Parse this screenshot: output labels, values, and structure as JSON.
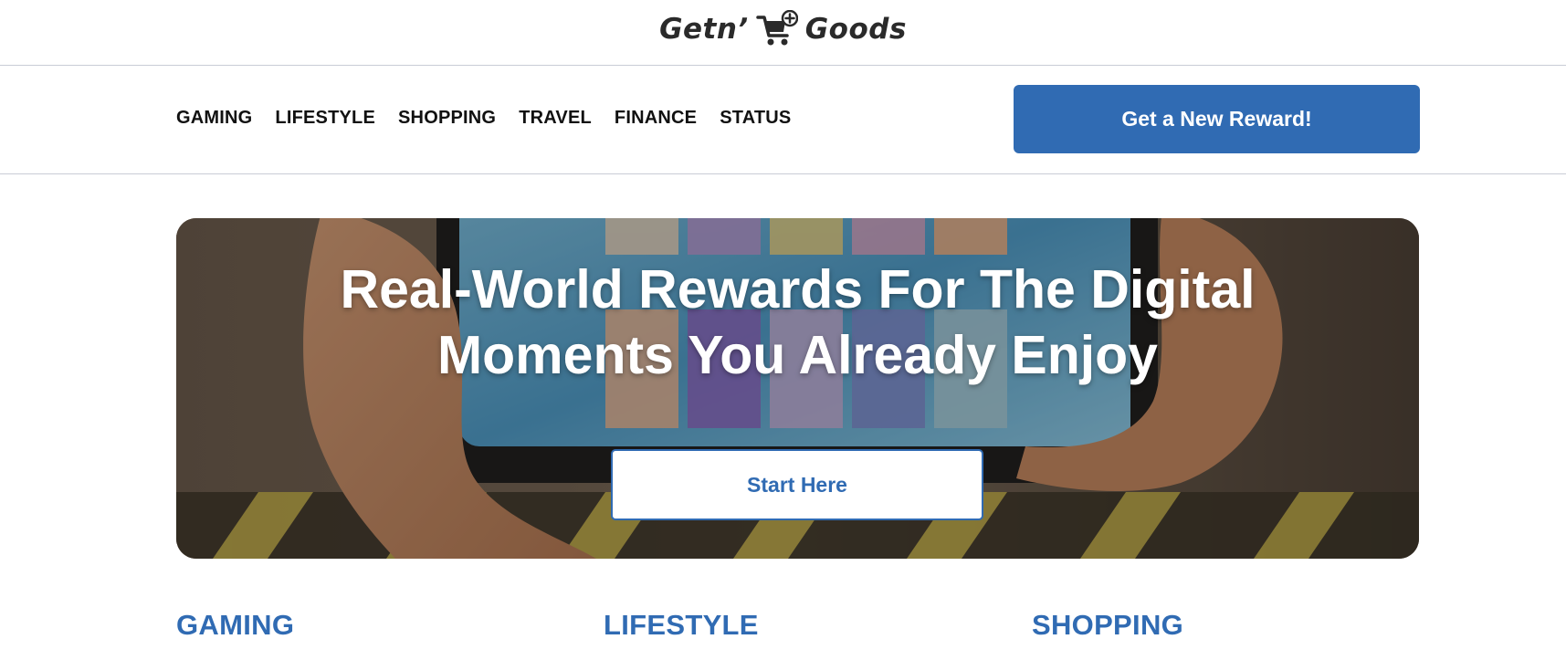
{
  "logo": {
    "text_left": "Getn’",
    "text_right": "Goods",
    "icon": "shopping-cart-plus-icon"
  },
  "nav": {
    "links": [
      {
        "label": "GAMING"
      },
      {
        "label": "LIFESTYLE"
      },
      {
        "label": "SHOPPING"
      },
      {
        "label": "TRAVEL"
      },
      {
        "label": "FINANCE"
      },
      {
        "label": "STATUS"
      }
    ],
    "cta_label": "Get a New Reward!"
  },
  "hero": {
    "title_line1": "Real-World Rewards For The Digital",
    "title_line2": "Moments You Already Enjoy",
    "button_label": "Start Here",
    "image": "hands-holding-phone-playing-card-game"
  },
  "categories": [
    {
      "label": "GAMING"
    },
    {
      "label": "LIFESTYLE"
    },
    {
      "label": "SHOPPING"
    }
  ],
  "colors": {
    "accent": "#306bb3",
    "text": "#111111",
    "divider": "#c9ccd6"
  }
}
